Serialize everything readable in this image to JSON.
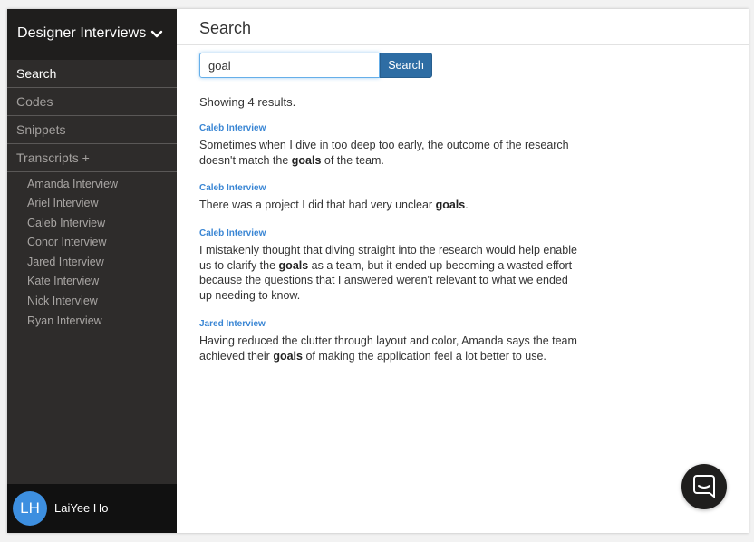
{
  "sidebar": {
    "project_title": "Designer Interviews",
    "nav": [
      {
        "label": "Search",
        "active": true
      },
      {
        "label": "Codes",
        "active": false
      },
      {
        "label": "Snippets",
        "active": false
      },
      {
        "label": "Transcripts +",
        "active": false
      }
    ],
    "transcripts": [
      "Amanda Interview",
      "Ariel Interview",
      "Caleb Interview",
      "Conor Interview",
      "Jared Interview",
      "Kate Interview",
      "Nick Interview",
      "Ryan Interview"
    ],
    "user": {
      "initials": "LH",
      "name": "LaiYee Ho"
    }
  },
  "main": {
    "title": "Search",
    "search": {
      "value": "goal",
      "button_label": "Search"
    },
    "result_count": "Showing 4 results.",
    "results": [
      {
        "source": "Caleb Interview",
        "before": "Sometimes when I dive in too deep too early, the outcome of the research doesn't match the ",
        "match": "goals",
        "after": " of the team."
      },
      {
        "source": "Caleb Interview",
        "before": "There was a project I did that had very unclear ",
        "match": "goals",
        "after": "."
      },
      {
        "source": "Caleb Interview",
        "before": "I mistakenly thought that diving straight into the research would help enable us to clarify the ",
        "match": "goals",
        "after": " as a team, but it ended up becoming a wasted effort because the questions that I answered weren't relevant to what we ended up needing to know."
      },
      {
        "source": "Jared Interview",
        "before": "Having reduced the clutter through layout and color, Amanda says the team achieved their ",
        "match": "goals",
        "after": " of making the application feel a lot better to use."
      }
    ]
  },
  "icons": {
    "project_dropdown": "chevron-down-icon",
    "chat": "chat-icon"
  },
  "colors": {
    "sidebar_bg": "#2e2c2b",
    "sidebar_header_bg": "#1f1e1d",
    "footer_bg": "#111111",
    "accent_link": "#3a86d4",
    "button_primary": "#2e6da4",
    "avatar_bg": "#3d8fe0"
  }
}
